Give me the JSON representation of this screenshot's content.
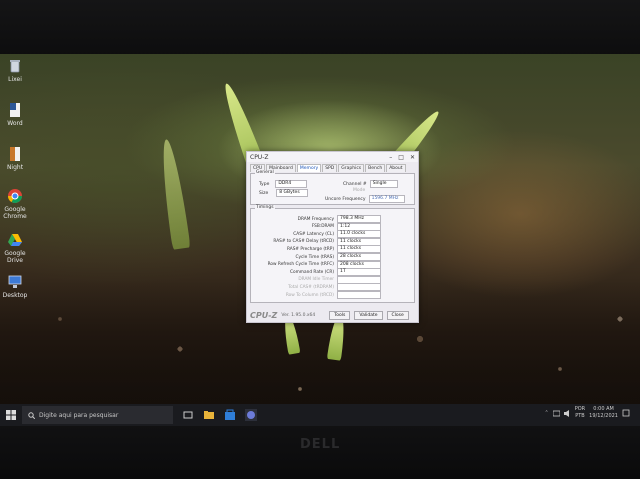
{
  "desktop_icons": [
    {
      "label": "Lixei",
      "icon": "recycle-bin-icon"
    },
    {
      "label": "Word",
      "icon": "word-file-icon"
    },
    {
      "label": "Night",
      "icon": "document-icon"
    },
    {
      "label": "Google Chrome",
      "icon": "chrome-icon"
    },
    {
      "label": "Google Drive",
      "icon": "google-drive-icon"
    },
    {
      "label": "Desktop",
      "icon": "network-icon"
    }
  ],
  "cpuz": {
    "title": "CPU-Z",
    "tabs": [
      "CPU",
      "Mainboard",
      "Memory",
      "SPD",
      "Graphics",
      "Bench",
      "About"
    ],
    "active_tab": "Memory",
    "general": {
      "group": "General",
      "type_label": "Type",
      "type_value": "DDR4",
      "size_label": "Size",
      "size_value": "8 GBytes",
      "channel_label": "Channel #",
      "channel_value": "Single",
      "mode_label": "Mode",
      "uncore_label": "Uncore Frequency",
      "uncore_value": "1596.7 MHz"
    },
    "timings": {
      "group": "Timings",
      "rows": [
        {
          "label": "DRAM Frequency",
          "value": "798.3 MHz",
          "dim": false
        },
        {
          "label": "FSB:DRAM",
          "value": "1:12",
          "dim": false
        },
        {
          "label": "CAS# Latency (CL)",
          "value": "11.0 clocks",
          "dim": false
        },
        {
          "label": "RAS# to CAS# Delay (tRCD)",
          "value": "11 clocks",
          "dim": false
        },
        {
          "label": "RAS# Precharge (tRP)",
          "value": "11 clocks",
          "dim": false
        },
        {
          "label": "Cycle Time (tRAS)",
          "value": "28 clocks",
          "dim": false
        },
        {
          "label": "Row Refresh Cycle Time (tRFC)",
          "value": "208 clocks",
          "dim": false
        },
        {
          "label": "Command Rate (CR)",
          "value": "1T",
          "dim": false
        },
        {
          "label": "DRAM Idle Timer",
          "value": "",
          "dim": true
        },
        {
          "label": "Total CAS# (tRDRAM)",
          "value": "",
          "dim": true
        },
        {
          "label": "Row To Column (tRCD)",
          "value": "",
          "dim": true
        }
      ]
    },
    "footer": {
      "logo": "CPU-Z",
      "version": "Ver. 1.95.0.x64",
      "tools": "Tools",
      "validate": "Validate",
      "close": "Close"
    }
  },
  "taskbar": {
    "search_placeholder": "Digite aqui para pesquisar",
    "tray_lang": "POR",
    "tray_layout": "PTB",
    "time": "0:00 AM",
    "date": "19/12/2021"
  }
}
